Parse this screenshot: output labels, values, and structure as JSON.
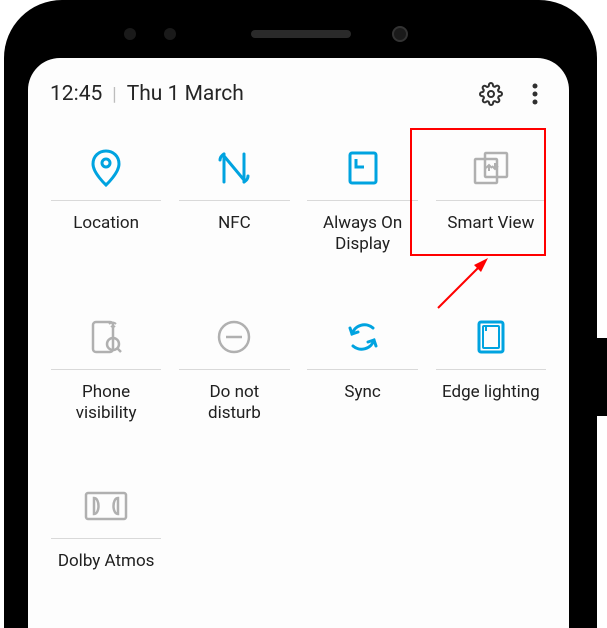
{
  "status": {
    "time": "12:45",
    "date": "Thu 1 March"
  },
  "tiles": {
    "location": "Location",
    "nfc": "NFC",
    "aod": "Always On\nDisplay",
    "smartview": "Smart View",
    "phonevis": "Phone\nvisibility",
    "dnd": "Do not\ndisturb",
    "sync": "Sync",
    "edgelight": "Edge lighting",
    "dolby": "Dolby Atmos"
  },
  "colors": {
    "active": "#00a3e0",
    "inactive": "#b0b0b0"
  }
}
